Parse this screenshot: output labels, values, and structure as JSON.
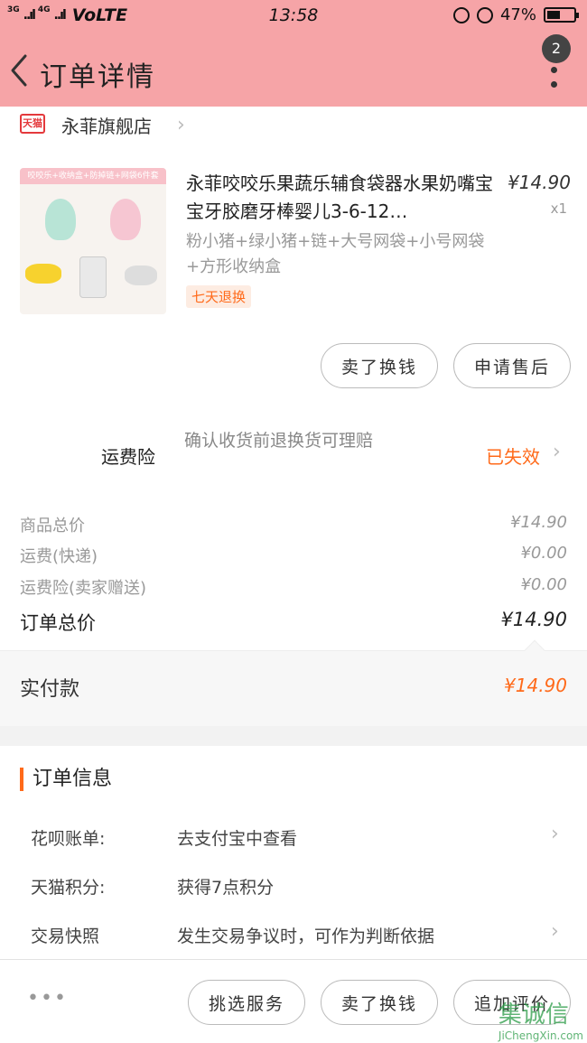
{
  "status_bar": {
    "network_1": "3G",
    "network_2": "4G",
    "signal": "..ıl",
    "carrier": "VoLTE",
    "time": "13:58",
    "battery": "47%"
  },
  "header": {
    "title": "订单详情",
    "badge": "2"
  },
  "shop": {
    "platform_icon": "天猫",
    "name": "永菲旗舰店"
  },
  "product": {
    "image_banner": "咬咬乐+收纳盒+防掉链+网袋6件套",
    "name": "永菲咬咬乐果蔬乐辅食袋器水果奶嘴宝宝牙胶磨牙棒婴儿3-6-12…",
    "price": "¥14.90",
    "qty": "x1",
    "sku": "粉小猪+绿小猪+链+大号网袋+小号网袋+方形收纳盒",
    "tag": "七天退换",
    "buttons": [
      "卖了换钱",
      "申请售后"
    ]
  },
  "insurance": {
    "label": "运费险",
    "desc": "确认收货前退换货可理赔",
    "status": "已失效"
  },
  "summary": {
    "rows": [
      {
        "k": "商品总价",
        "v": "¥14.90"
      },
      {
        "k": "运费(快递)",
        "v": "¥0.00"
      },
      {
        "k": "运费险(卖家赠送)",
        "v": "¥0.00"
      }
    ],
    "total_label": "订单总价",
    "total_value": "¥14.90"
  },
  "paid": {
    "label": "实付款",
    "value": "¥14.90"
  },
  "order_info": {
    "title": "订单信息",
    "rows": [
      {
        "k": "花呗账单:",
        "v": "去支付宝中查看"
      },
      {
        "k": "天猫积分:",
        "v": "获得7点积分"
      },
      {
        "k": "交易快照",
        "v": "发生交易争议时，可作为判断依据"
      }
    ]
  },
  "bottom_bar": {
    "more": "•••",
    "buttons": [
      "挑选服务",
      "卖了换钱",
      "追加评价"
    ]
  },
  "watermark": {
    "text": "集诚信",
    "url_text": "JiChengXin.com"
  },
  "colors": {
    "header_bg": "#f6a4a7",
    "accent": "#ff6a1a",
    "tmall_red": "#e4393c"
  }
}
